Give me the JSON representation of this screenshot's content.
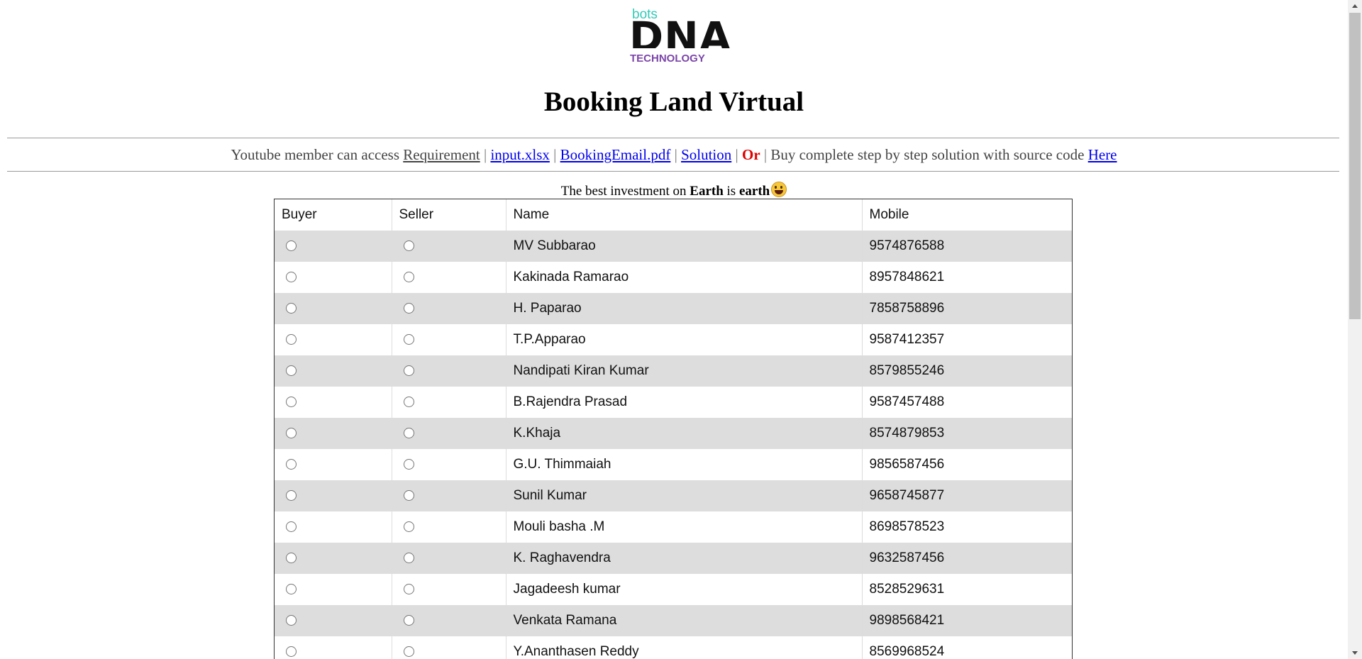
{
  "logo": {
    "top_text": "bots",
    "main_text": "DNA",
    "bottom_text": "TECHNOLOGY",
    "colors": {
      "top": "#35c9b8",
      "main": "#111111",
      "bottom": "#7b45a8"
    }
  },
  "title": "Booking Land Virtual",
  "access": {
    "prefix": "Youtube member can access",
    "links": {
      "requirement": "Requirement",
      "input": "input.xlsx",
      "booking_email": "BookingEmail.pdf",
      "solution": "Solution"
    },
    "separator": "|",
    "or": "Or",
    "buy_text": "Buy complete step by step solution with source code",
    "here": "Here"
  },
  "tagline": {
    "pre": "The best investment on",
    "bold1": "Earth",
    "mid": "is",
    "bold2": "earth",
    "emoji": "grinning-face-icon"
  },
  "table": {
    "headers": {
      "buyer": "Buyer",
      "seller": "Seller",
      "name": "Name",
      "mobile": "Mobile"
    },
    "rows": [
      {
        "name": "MV Subbarao",
        "mobile": "9574876588"
      },
      {
        "name": "Kakinada Ramarao",
        "mobile": "8957848621"
      },
      {
        "name": "H. Paparao",
        "mobile": "7858758896"
      },
      {
        "name": "T.P.Apparao",
        "mobile": "9587412357"
      },
      {
        "name": "Nandipati Kiran Kumar",
        "mobile": "8579855246"
      },
      {
        "name": "B.Rajendra Prasad",
        "mobile": "9587457488"
      },
      {
        "name": "K.Khaja",
        "mobile": "8574879853"
      },
      {
        "name": "G.U. Thimmaiah",
        "mobile": "9856587456"
      },
      {
        "name": "Sunil Kumar",
        "mobile": "9658745877"
      },
      {
        "name": "Mouli basha .M",
        "mobile": "8698578523"
      },
      {
        "name": "K. Raghavendra",
        "mobile": "9632587456"
      },
      {
        "name": "Jagadeesh kumar",
        "mobile": "8528529631"
      },
      {
        "name": "Venkata Ramana",
        "mobile": "9898568421"
      },
      {
        "name": "Y.Ananthasen Reddy",
        "mobile": "8569968524"
      }
    ]
  }
}
